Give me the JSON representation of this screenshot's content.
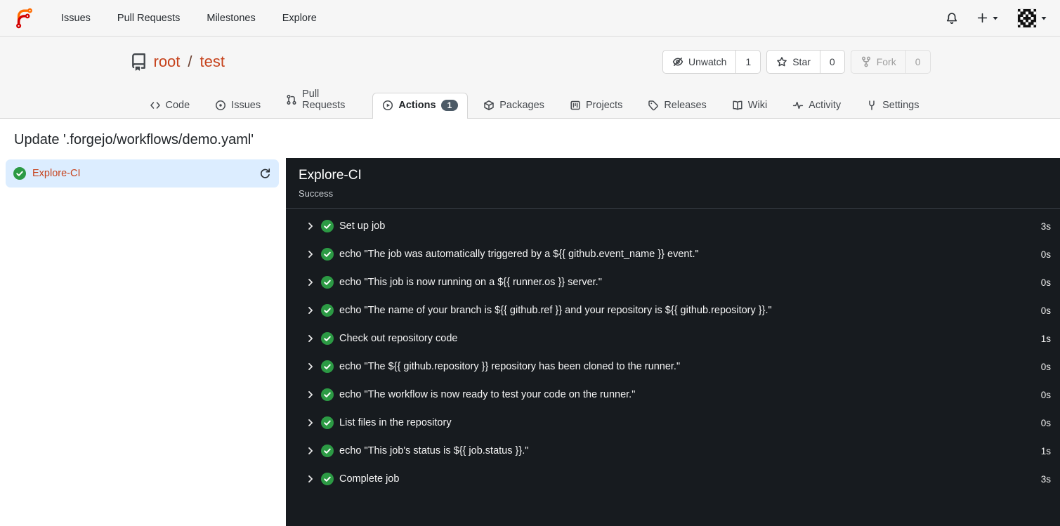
{
  "colors": {
    "brand_orange": "#ff6b00",
    "brand_red": "#d40000",
    "link_accent": "#c6421c",
    "success_green": "#2c9a44",
    "badge_bg": "#4c5a66",
    "panel_bg": "#171b1f",
    "selected_job_bg": "#dcedff"
  },
  "navbar": {
    "items": [
      {
        "id": "issues",
        "label": "Issues"
      },
      {
        "id": "pull-requests",
        "label": "Pull Requests"
      },
      {
        "id": "milestones",
        "label": "Milestones"
      },
      {
        "id": "explore",
        "label": "Explore"
      }
    ],
    "right_icons": [
      "bell-icon",
      "plus-icon",
      "avatar-identicon"
    ]
  },
  "repo": {
    "owner": "root",
    "separator": "/",
    "name": "test",
    "actions": [
      {
        "id": "unwatch",
        "label": "Unwatch",
        "icon": "eye-off-icon",
        "count": "1",
        "disabled": false
      },
      {
        "id": "star",
        "label": "Star",
        "icon": "star-icon",
        "count": "0",
        "disabled": false
      },
      {
        "id": "fork",
        "label": "Fork",
        "icon": "fork-icon",
        "count": "0",
        "disabled": true
      }
    ],
    "tabs": [
      {
        "id": "code",
        "label": "Code",
        "icon": "code-icon",
        "active": false
      },
      {
        "id": "issues",
        "label": "Issues",
        "icon": "issue-circle-icon",
        "active": false
      },
      {
        "id": "pull-requests",
        "label": "Pull Requests",
        "icon": "pull-request-icon",
        "active": false
      },
      {
        "id": "actions",
        "label": "Actions",
        "icon": "play-circle-icon",
        "badge": "1",
        "active": true
      },
      {
        "id": "packages",
        "label": "Packages",
        "icon": "package-icon",
        "active": false
      },
      {
        "id": "projects",
        "label": "Projects",
        "icon": "project-board-icon",
        "active": false
      },
      {
        "id": "releases",
        "label": "Releases",
        "icon": "tag-icon",
        "active": false
      },
      {
        "id": "wiki",
        "label": "Wiki",
        "icon": "book-icon",
        "active": false
      },
      {
        "id": "activity",
        "label": "Activity",
        "icon": "pulse-icon",
        "active": false
      },
      {
        "id": "settings",
        "label": "Settings",
        "icon": "tool-icon",
        "active": false,
        "right": true
      }
    ]
  },
  "run": {
    "title": "Update '.forgejo/workflows/demo.yaml'",
    "jobs": [
      {
        "name": "Explore-CI",
        "status": "success"
      }
    ],
    "panel": {
      "job_name": "Explore-CI",
      "status_text": "Success",
      "steps": [
        {
          "name": "Set up job",
          "duration": "3s",
          "status": "success"
        },
        {
          "name": "echo \"The job was automatically triggered by a ${{ github.event_name }} event.\"",
          "duration": "0s",
          "status": "success"
        },
        {
          "name": "echo \"This job is now running on a ${{ runner.os }} server.\"",
          "duration": "0s",
          "status": "success"
        },
        {
          "name": "echo \"The name of your branch is ${{ github.ref }} and your repository is ${{ github.repository }}.\"",
          "duration": "0s",
          "status": "success"
        },
        {
          "name": "Check out repository code",
          "duration": "1s",
          "status": "success"
        },
        {
          "name": "echo \"The ${{ github.repository }} repository has been cloned to the runner.\"",
          "duration": "0s",
          "status": "success"
        },
        {
          "name": "echo \"The workflow is now ready to test your code on the runner.\"",
          "duration": "0s",
          "status": "success"
        },
        {
          "name": "List files in the repository",
          "duration": "0s",
          "status": "success"
        },
        {
          "name": "echo \"This job's status is ${{ job.status }}.\"",
          "duration": "1s",
          "status": "success"
        },
        {
          "name": "Complete job",
          "duration": "3s",
          "status": "success"
        }
      ]
    }
  }
}
